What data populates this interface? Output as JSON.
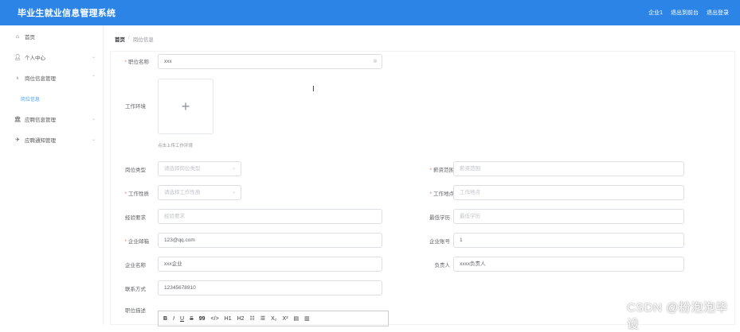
{
  "header": {
    "title": "毕业生就业信息管理系统",
    "links": [
      "企业1",
      "退出到前台",
      "退出登录"
    ]
  },
  "sidebar": {
    "items": [
      {
        "label": "首页",
        "icon": "home-icon"
      },
      {
        "label": "个人中心",
        "icon": "user-icon"
      },
      {
        "label": "岗位信息管理",
        "icon": "bulb-icon"
      },
      {
        "label": "岗位信息",
        "icon": ""
      },
      {
        "label": "应聘信息管理",
        "icon": "bank-icon"
      },
      {
        "label": "应聘通知管理",
        "icon": "send-icon"
      }
    ]
  },
  "breadcrumb": {
    "home": "首页",
    "separator": "/",
    "current": "岗位信息"
  },
  "form": {
    "job_name": {
      "label": "职位名称",
      "value": "xxx"
    },
    "work_env": {
      "label": "工作环境",
      "upload_tip": "点击上传工作环境"
    },
    "job_type": {
      "label": "岗位类型",
      "placeholder": "请选择岗位类型"
    },
    "salary": {
      "label": "薪资范围",
      "placeholder": "薪资范围"
    },
    "work_nature": {
      "label": "工作性质",
      "placeholder": "请选择工作性质"
    },
    "work_location": {
      "label": "工作地点",
      "placeholder": "工作地点"
    },
    "experience": {
      "label": "经验要求",
      "placeholder": "经验要求"
    },
    "education": {
      "label": "最低学历",
      "placeholder": "最低学历"
    },
    "email": {
      "label": "企业邮箱",
      "value": "123@qq.com"
    },
    "account": {
      "label": "企业账号",
      "value": "1"
    },
    "company_name": {
      "label": "企业名称",
      "value": "xxx企业"
    },
    "manager": {
      "label": "负责人",
      "value": "xxxx负责人"
    },
    "contact": {
      "label": "联系方式",
      "value": "12345678910"
    },
    "description": {
      "label": "职位描述"
    }
  },
  "editor_toolbar": [
    "B",
    "I",
    "U",
    "S",
    "99",
    "</>",
    "H1",
    "H2",
    "☷",
    "☰",
    "X₂",
    "X²",
    "▤",
    "▥"
  ],
  "watermark": "CSDN @粉泡泡毕设",
  "colors": {
    "header_bg": "#2c85e6",
    "accent": "#409eff",
    "required": "#f56c6c"
  }
}
